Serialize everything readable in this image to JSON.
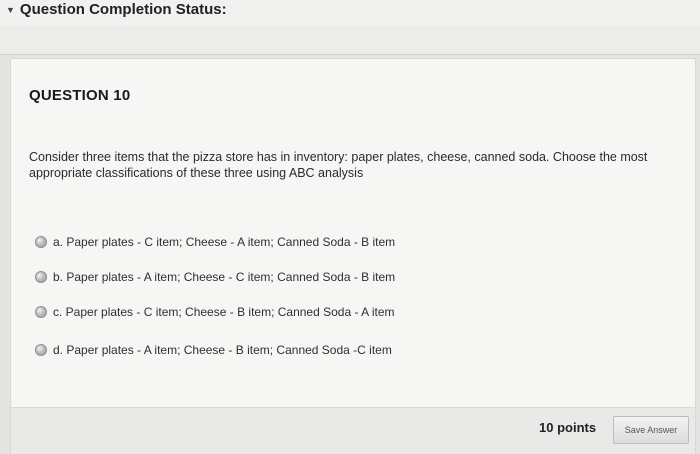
{
  "header": {
    "status_label": "Question Completion Status:",
    "toggle_icon": "caret-down-icon"
  },
  "question": {
    "title": "QUESTION 10",
    "text": "Consider three items that the pizza store has in inventory: paper plates, cheese, canned soda. Choose the most appropriate classifications of these three using ABC analysis",
    "options": [
      {
        "label": "a. Paper plates - C item; Cheese - A item; Canned Soda - B item"
      },
      {
        "label": "b. Paper plates - A item; Cheese - C item; Canned Soda - B item"
      },
      {
        "label": "c. Paper plates - C item; Cheese - B item; Canned Soda - A item"
      },
      {
        "label": "d. Paper plates - A item; Cheese - B item; Canned Soda -C item"
      }
    ],
    "selected_option": null
  },
  "footer": {
    "points": "10 points",
    "save_label": "Save Answer"
  }
}
